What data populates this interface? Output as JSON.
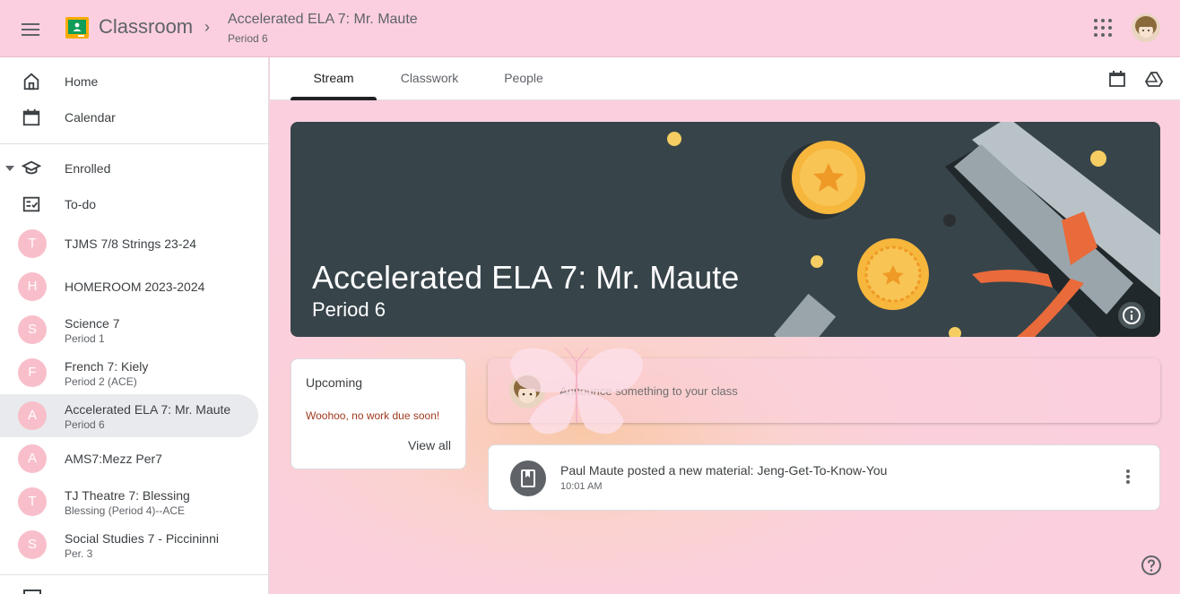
{
  "header": {
    "brand": "Classroom",
    "breadcrumb_title": "Accelerated ELA 7: Mr. Maute",
    "breadcrumb_subtitle": "Period 6"
  },
  "sidebar": {
    "top_items": [
      {
        "label": "Home",
        "icon": "home-icon"
      },
      {
        "label": "Calendar",
        "icon": "calendar-icon"
      }
    ],
    "enrolled_label": "Enrolled",
    "todo_label": "To-do",
    "courses": [
      {
        "initial": "T",
        "name": "TJMS 7/8 Strings 23-24",
        "section": ""
      },
      {
        "initial": "H",
        "name": "HOMEROOM 2023-2024",
        "section": ""
      },
      {
        "initial": "S",
        "name": "Science 7",
        "section": "Period 1"
      },
      {
        "initial": "F",
        "name": "French 7: Kiely",
        "section": "Period 2 (ACE)"
      },
      {
        "initial": "A",
        "name": "Accelerated ELA 7: Mr. Maute",
        "section": "Period 6"
      },
      {
        "initial": "A",
        "name": "AMS7:Mezz Per7",
        "section": ""
      },
      {
        "initial": "T",
        "name": "TJ Theatre 7: Blessing",
        "section": "Blessing (Period 4)--ACE"
      },
      {
        "initial": "S",
        "name": "Social Studies 7 - Piccininni",
        "section": "Per. 3"
      }
    ]
  },
  "tabs": [
    {
      "label": "Stream",
      "active": true
    },
    {
      "label": "Classwork",
      "active": false
    },
    {
      "label": "People",
      "active": false
    }
  ],
  "banner": {
    "title": "Accelerated ELA 7: Mr. Maute",
    "subtitle": "Period 6"
  },
  "upcoming": {
    "title": "Upcoming",
    "message": "Woohoo, no work due soon!",
    "link": "View all"
  },
  "announce": {
    "placeholder": "Announce something to your class"
  },
  "posts": [
    {
      "title": "Paul Maute posted a new material: Jeng-Get-To-Know-You",
      "time": "10:01 AM"
    }
  ],
  "colors": {
    "topbar": "#fbcfe0",
    "banner": "#37444a",
    "course_circle": "#f8bfcb",
    "upcoming_message": "#a03a1e"
  }
}
